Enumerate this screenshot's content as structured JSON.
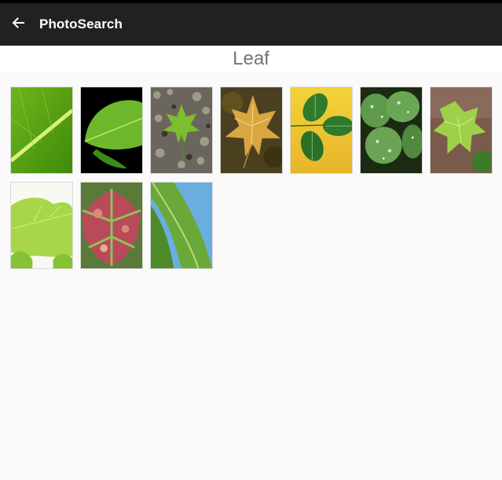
{
  "toolbar": {
    "back_icon": "arrow-left-icon",
    "title": "PhotoSearch",
    "background_color": "#212121"
  },
  "query": {
    "title": "Leaf"
  },
  "results": [
    {
      "name": "result-photo-1",
      "subject": "green leaf close-up with diagonal vein"
    },
    {
      "name": "result-photo-2",
      "subject": "green leaf on black background"
    },
    {
      "name": "result-photo-3",
      "subject": "maple leaf on gravel"
    },
    {
      "name": "result-photo-4",
      "subject": "autumn maple leaf"
    },
    {
      "name": "result-photo-5",
      "subject": "rose leaves on yellow background"
    },
    {
      "name": "result-photo-6",
      "subject": "leaves with water drops"
    },
    {
      "name": "result-photo-7",
      "subject": "light green vine leaf"
    },
    {
      "name": "result-photo-8",
      "subject": "oak leaves on white"
    },
    {
      "name": "result-photo-9",
      "subject": "red and green variegated leaf"
    },
    {
      "name": "result-photo-10",
      "subject": "grass blade against blue sky"
    }
  ]
}
